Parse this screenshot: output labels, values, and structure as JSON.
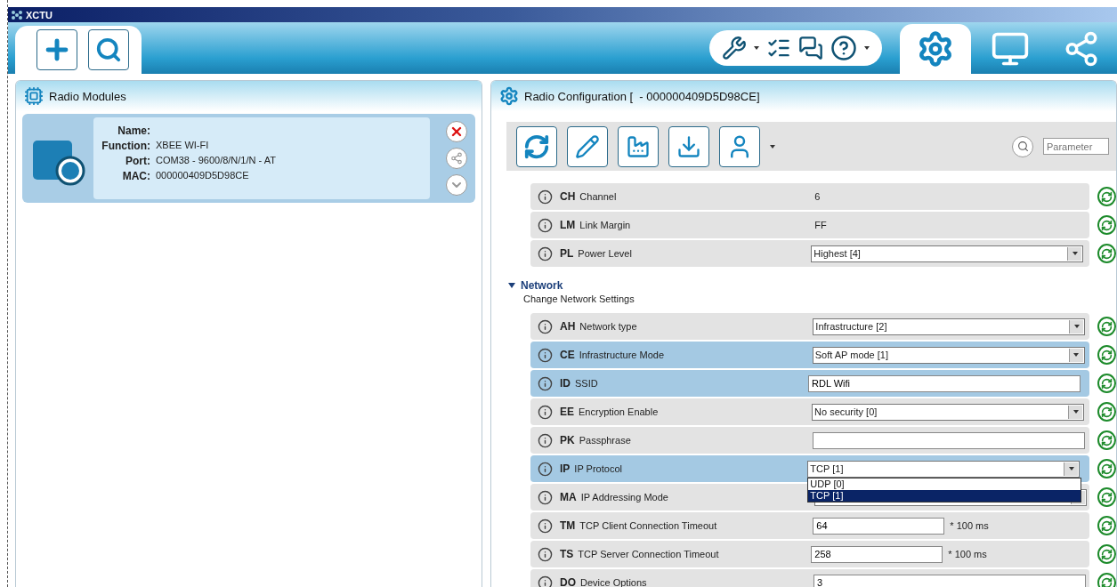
{
  "title_bar": {
    "title": "XCTU"
  },
  "perspectives": [
    {
      "kind": "configuration",
      "selected": true
    },
    {
      "kind": "console",
      "selected": false
    },
    {
      "kind": "network",
      "selected": false
    }
  ],
  "modules_panel": {
    "title": "Radio Modules",
    "modules": [
      {
        "selected": true,
        "fields": [
          {
            "label": "Name:"
          },
          {
            "label": "Function:",
            "value": "XBEE WI-FI"
          },
          {
            "label": "Port:",
            "value": "COM38 - 9600/8/N/1/N - AT"
          },
          {
            "label": "MAC:",
            "value": "000000409D5D98CE"
          }
        ]
      }
    ]
  },
  "config_panel": {
    "title": "Radio Configuration [  - 000000409D5D98CE]",
    "search": {
      "placeholder": "Parameter"
    },
    "sections": [
      {
        "rows": [
          {
            "code": "CH",
            "name": "Channel",
            "kind": "text",
            "value": "6",
            "selected": false
          },
          {
            "code": "LM",
            "name": "Link Margin",
            "kind": "text",
            "value": "FF",
            "selected": false
          },
          {
            "code": "PL",
            "name": "Power Level",
            "kind": "combo",
            "value": "Highest [4]",
            "selected": false
          }
        ]
      },
      {
        "title": "Network",
        "subtitle": "Change Network Settings",
        "expanded": true,
        "rows": [
          {
            "code": "AH",
            "name": "Network type",
            "kind": "combo",
            "value": "Infrastructure [2]",
            "selected": false
          },
          {
            "code": "CE",
            "name": "Infrastructure Mode",
            "kind": "combo",
            "value": "Soft AP mode [1]",
            "selected": true
          },
          {
            "code": "ID",
            "name": "SSID",
            "kind": "input",
            "value": "RDL Wifi",
            "selected": true
          },
          {
            "code": "EE",
            "name": "Encryption Enable",
            "kind": "combo",
            "value": "No security [0]",
            "selected": false
          },
          {
            "code": "PK",
            "name": "Passphrase",
            "kind": "input",
            "selected": false
          },
          {
            "code": "IP",
            "name": "IP Protocol",
            "kind": "combo",
            "value": "TCP [1]",
            "selected": true,
            "options": [
              {
                "label": "UDP [0]",
                "selected": false
              },
              {
                "label": "TCP [1]",
                "selected": true
              }
            ]
          },
          {
            "code": "MA",
            "name": "IP Addressing Mode",
            "kind": "combo",
            "selected": false
          },
          {
            "code": "TM",
            "name": "TCP Client Connection Timeout",
            "kind": "number",
            "value": "64",
            "unit": "* 100 ms",
            "selected": false
          },
          {
            "code": "TS",
            "name": "TCP Server Connection Timeout",
            "kind": "number",
            "value": "258",
            "unit": "* 100 ms",
            "selected": false
          },
          {
            "code": "DO",
            "name": "Device Options",
            "kind": "input",
            "value": "3",
            "selected": false
          }
        ]
      }
    ]
  }
}
